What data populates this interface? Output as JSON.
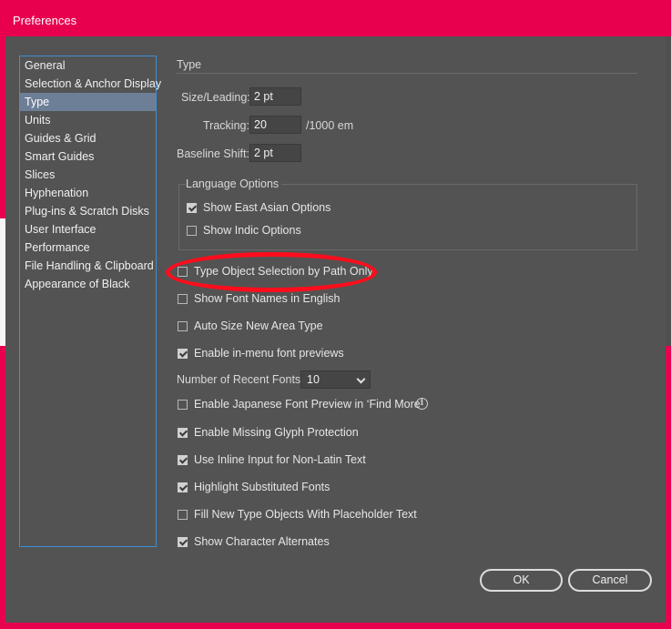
{
  "window": {
    "title": "Preferences"
  },
  "sidebar": {
    "items": [
      {
        "label": "General"
      },
      {
        "label": "Selection & Anchor Display"
      },
      {
        "label": "Type",
        "selected": true
      },
      {
        "label": "Units"
      },
      {
        "label": "Guides & Grid"
      },
      {
        "label": "Smart Guides"
      },
      {
        "label": "Slices"
      },
      {
        "label": "Hyphenation"
      },
      {
        "label": "Plug-ins & Scratch Disks"
      },
      {
        "label": "User Interface"
      },
      {
        "label": "Performance"
      },
      {
        "label": "File Handling & Clipboard"
      },
      {
        "label": "Appearance of Black"
      }
    ]
  },
  "type_panel": {
    "section_title": "Type",
    "size_leading": {
      "label": "Size/Leading:",
      "value": "2 pt"
    },
    "tracking": {
      "label": "Tracking:",
      "value": "20",
      "unit": "/1000 em"
    },
    "baseline_shift": {
      "label": "Baseline Shift:",
      "value": "2 pt"
    },
    "language_options": {
      "legend": "Language Options",
      "show_east_asian": {
        "label": "Show East Asian Options",
        "checked": true
      },
      "show_indic": {
        "label": "Show Indic Options",
        "checked": false
      }
    },
    "type_object_selection": {
      "label": "Type Object Selection by Path Only",
      "checked": false
    },
    "show_font_names_english": {
      "label": "Show Font Names in English",
      "checked": false
    },
    "auto_size_area_type": {
      "label": "Auto Size New Area Type",
      "checked": false
    },
    "in_menu_font_previews": {
      "label": "Enable in-menu font previews",
      "checked": true
    },
    "recent_fonts": {
      "label": "Number of Recent Fonts:",
      "value": "10"
    },
    "japanese_font_preview": {
      "label": "Enable Japanese Font Preview in ‘Find More’",
      "checked": false,
      "info_icon": "info-icon"
    },
    "missing_glyph_protection": {
      "label": "Enable Missing Glyph Protection",
      "checked": true
    },
    "inline_input": {
      "label": "Use Inline Input for Non-Latin Text",
      "checked": true
    },
    "highlight_substituted": {
      "label": "Highlight Substituted Fonts",
      "checked": true
    },
    "placeholder_text": {
      "label": "Fill New Type Objects With Placeholder Text",
      "checked": false
    },
    "character_alternates": {
      "label": "Show Character Alternates",
      "checked": true
    }
  },
  "buttons": {
    "ok": "OK",
    "cancel": "Cancel"
  },
  "colors": {
    "accent": "#e8004f",
    "panel": "#535353",
    "selection": "#6d7f97",
    "annotation_ring": "#ff0d1c"
  }
}
